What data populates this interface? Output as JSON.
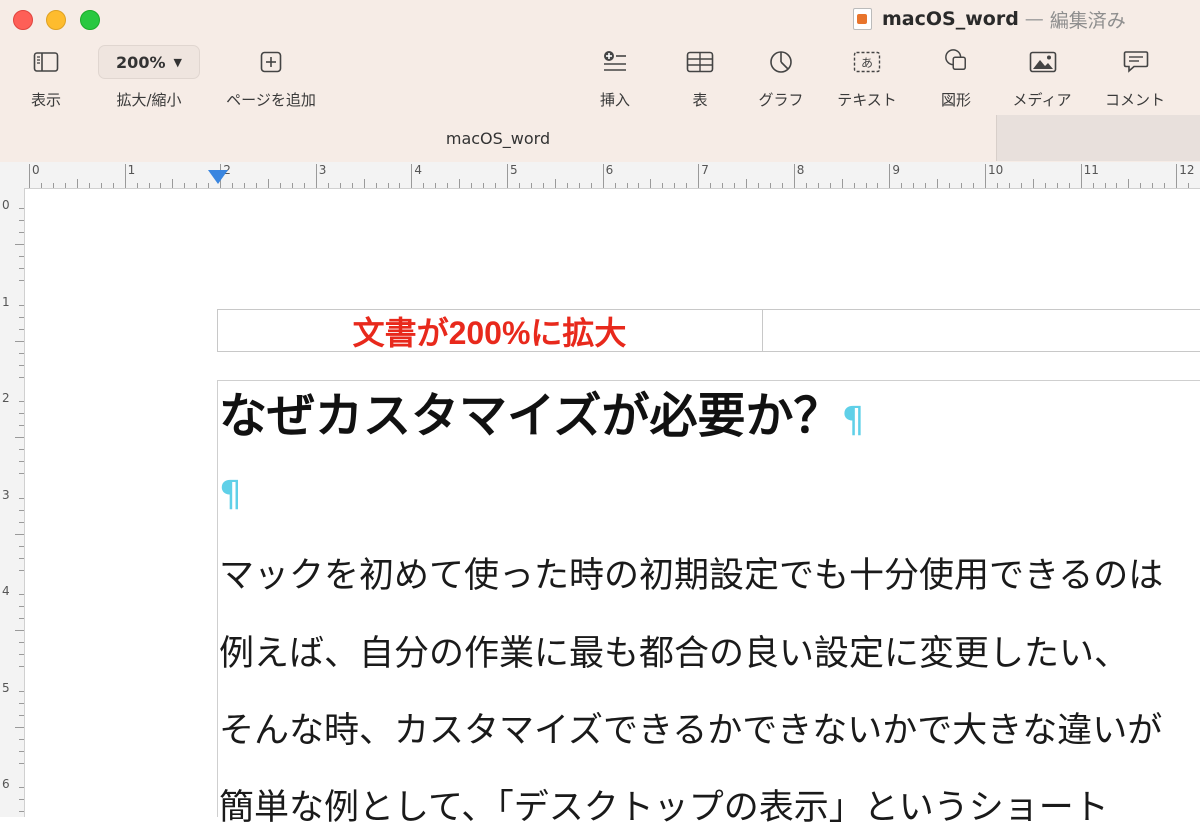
{
  "window": {
    "title": "macOS_word",
    "separator": "—",
    "status": "編集済み"
  },
  "toolbar": {
    "view_label": "表示",
    "zoom_value": "200%",
    "zoom_label": "拡大/縮小",
    "add_page_label": "ページを追加",
    "insert_label": "挿入",
    "table_label": "表",
    "chart_label": "グラフ",
    "text_label": "テキスト",
    "shape_label": "図形",
    "media_label": "メディア",
    "comment_label": "コメント"
  },
  "tabs": {
    "active": "macOS_word"
  },
  "ruler": {
    "horizontal": [
      "0",
      "1",
      "2",
      "3",
      "4",
      "5",
      "6",
      "7",
      "8",
      "9",
      "10",
      "11",
      "12"
    ],
    "vertical": [
      "0",
      "1",
      "2",
      "3",
      "4",
      "5",
      "6"
    ]
  },
  "document": {
    "annotation": "文書が200%に拡大",
    "heading": "なぜカスタマイズが必要か？",
    "pilcrow": "¶",
    "lines": [
      "マックを初めて使った時の初期設定でも十分使用できるのは",
      "例えば、自分の作業に最も都合の良い設定に変更したい、",
      "そんな時、カスタマイズできるかできないかで大きな違いが",
      "簡単な例として、「デスクトップの表示」というショート"
    ]
  },
  "colors": {
    "annotation": "#e8291c",
    "pilcrow": "#5fd0e8",
    "toolbar_bg": "#f6ece6"
  }
}
